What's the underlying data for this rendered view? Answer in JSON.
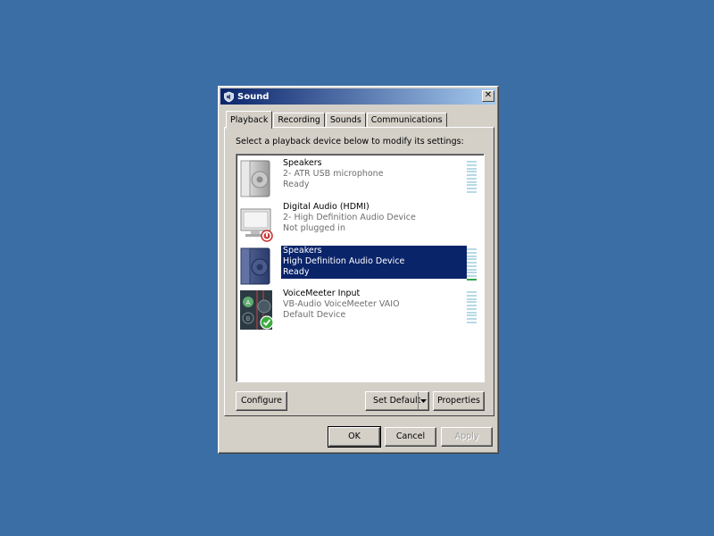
{
  "window": {
    "title": "Sound",
    "close_glyph": "✕"
  },
  "tabs": [
    {
      "label": "Playback",
      "active": true
    },
    {
      "label": "Recording",
      "active": false
    },
    {
      "label": "Sounds",
      "active": false
    },
    {
      "label": "Communications",
      "active": false
    }
  ],
  "playback": {
    "instruction": "Select a playback device below to modify its settings:",
    "devices": [
      {
        "name": "Speakers",
        "description": "2- ATR USB microphone",
        "status": "Ready",
        "icon": "speaker-icon",
        "selected": false
      },
      {
        "name": "Digital Audio (HDMI)",
        "description": "2- High Definition Audio Device",
        "status": "Not plugged in",
        "icon": "monitor-icon",
        "selected": false
      },
      {
        "name": "Speakers",
        "description": "High Definition Audio Device",
        "status": "Ready",
        "icon": "speaker-icon",
        "selected": true
      },
      {
        "name": "VoiceMeeter Input",
        "description": "VB-Audio VoiceMeeter VAIO",
        "status": "Default Device",
        "icon": "voicemeeter-icon",
        "selected": false
      }
    ],
    "configure_label": "Configure",
    "set_default_label": "Set Default",
    "properties_label": "Properties"
  },
  "footer": {
    "ok_label": "OK",
    "cancel_label": "Cancel",
    "apply_label": "Apply"
  },
  "colors": {
    "desktop": "#3a6ea5",
    "title_start": "#0a246a",
    "title_end": "#a6caf0",
    "selection": "#0a246a",
    "meter_idle": "#b7d9e6",
    "meter_active": "#2fa84f"
  }
}
